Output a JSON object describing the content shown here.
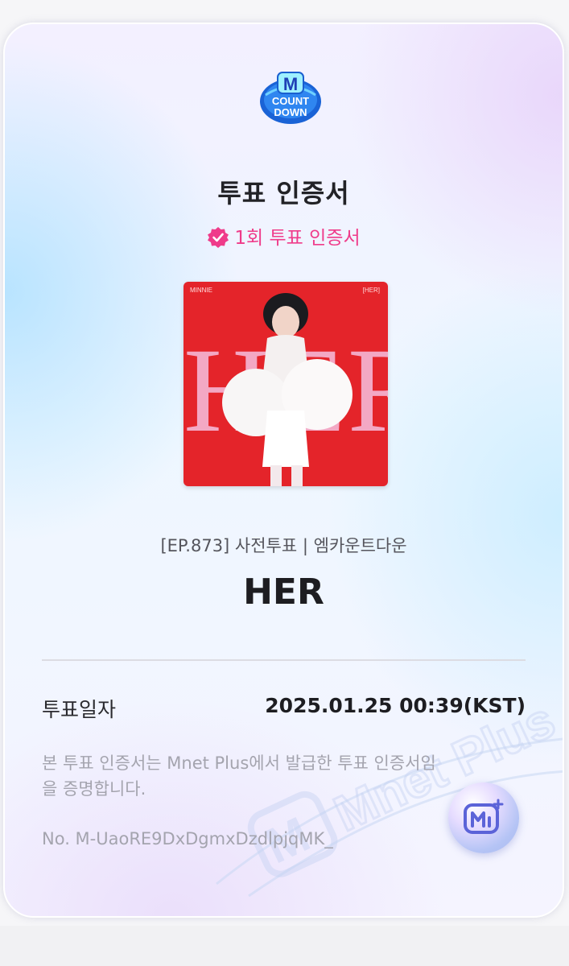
{
  "certificate": {
    "logo_alt": "M COUNTDOWN",
    "logo_lines": [
      "M",
      "COUNT",
      "DOWN"
    ],
    "title": "투표 인증서",
    "badge_text": "1회 투표 인증서",
    "badge_icon": "verified-check-icon",
    "album": {
      "artist_small": "MINNIE",
      "title_small": "[HER]",
      "cover_text": "HER"
    },
    "episode_line": "[EP.873] 사전투표 | 엠카운트다운",
    "song_title": "HER",
    "vote_date_label": "투표일자",
    "vote_date_value": "2025.01.25 00:39(KST)",
    "description": "본 투표 인증서는 Mnet Plus에서 발급한 투표 인증서임을 증명합니다.",
    "serial": "No. M-UaoRE9DxDgmxDzdlpjqMK_",
    "watermark_text": "Mnet Plus"
  },
  "colors": {
    "accent_pink": "#ef3b8a",
    "album_red": "#e4242a"
  }
}
